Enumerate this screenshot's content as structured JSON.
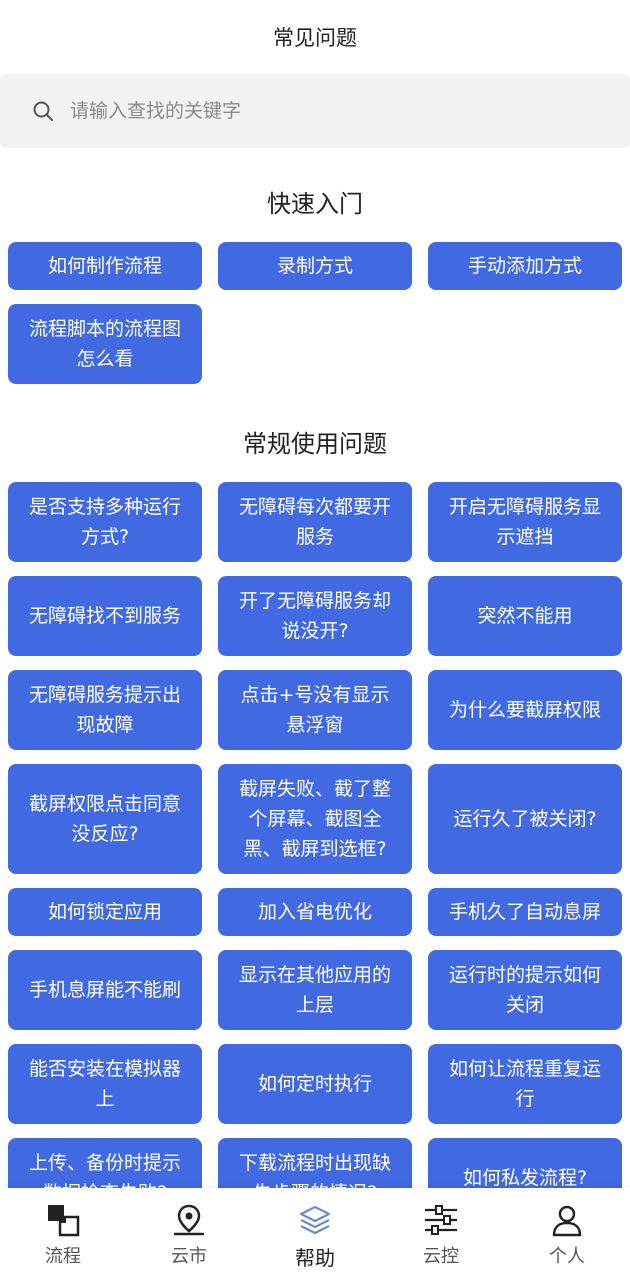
{
  "header": {
    "title": "常见问题"
  },
  "search": {
    "placeholder": "请输入查找的关键字"
  },
  "quick_start": {
    "title": "快速入门",
    "items": [
      "如何制作流程",
      "录制方式",
      "手动添加方式",
      "流程脚本的流程图怎么看"
    ]
  },
  "common": {
    "title": "常规使用问题",
    "items": [
      "是否支持多种运行方式?",
      "无障碍每次都要开服务",
      "开启无障碍服务显示遮挡",
      "无障碍找不到服务",
      "开了无障碍服务却说没开?",
      "突然不能用",
      "无障碍服务提示出现故障",
      "点击+号没有显示悬浮窗",
      "为什么要截屏权限",
      "截屏权限点击同意没反应?",
      "截屏失败、截了整个屏幕、截图全黑、截屏到选框?",
      "运行久了被关闭?",
      "如何锁定应用",
      "加入省电优化",
      "手机久了自动息屏",
      "手机息屏能不能刷",
      "显示在其他应用的上层",
      "运行时的提示如何关闭",
      "能否安装在模拟器上",
      "如何定时执行",
      "如何让流程重复运行",
      "上传、备份时提示数据检查失败?",
      "下载流程时出现缺失步骤的情况?",
      "如何私发流程?"
    ]
  },
  "tabbar": {
    "items": [
      {
        "label": "流程",
        "icon": "flow-icon",
        "active": false
      },
      {
        "label": "云市",
        "icon": "location-icon",
        "active": false
      },
      {
        "label": "帮助",
        "icon": "layers-icon",
        "active": true
      },
      {
        "label": "云控",
        "icon": "sliders-icon",
        "active": false
      },
      {
        "label": "个人",
        "icon": "person-icon",
        "active": false
      }
    ]
  },
  "colors": {
    "accent": "#4169e1",
    "help_icon": "#6b8bd6"
  }
}
